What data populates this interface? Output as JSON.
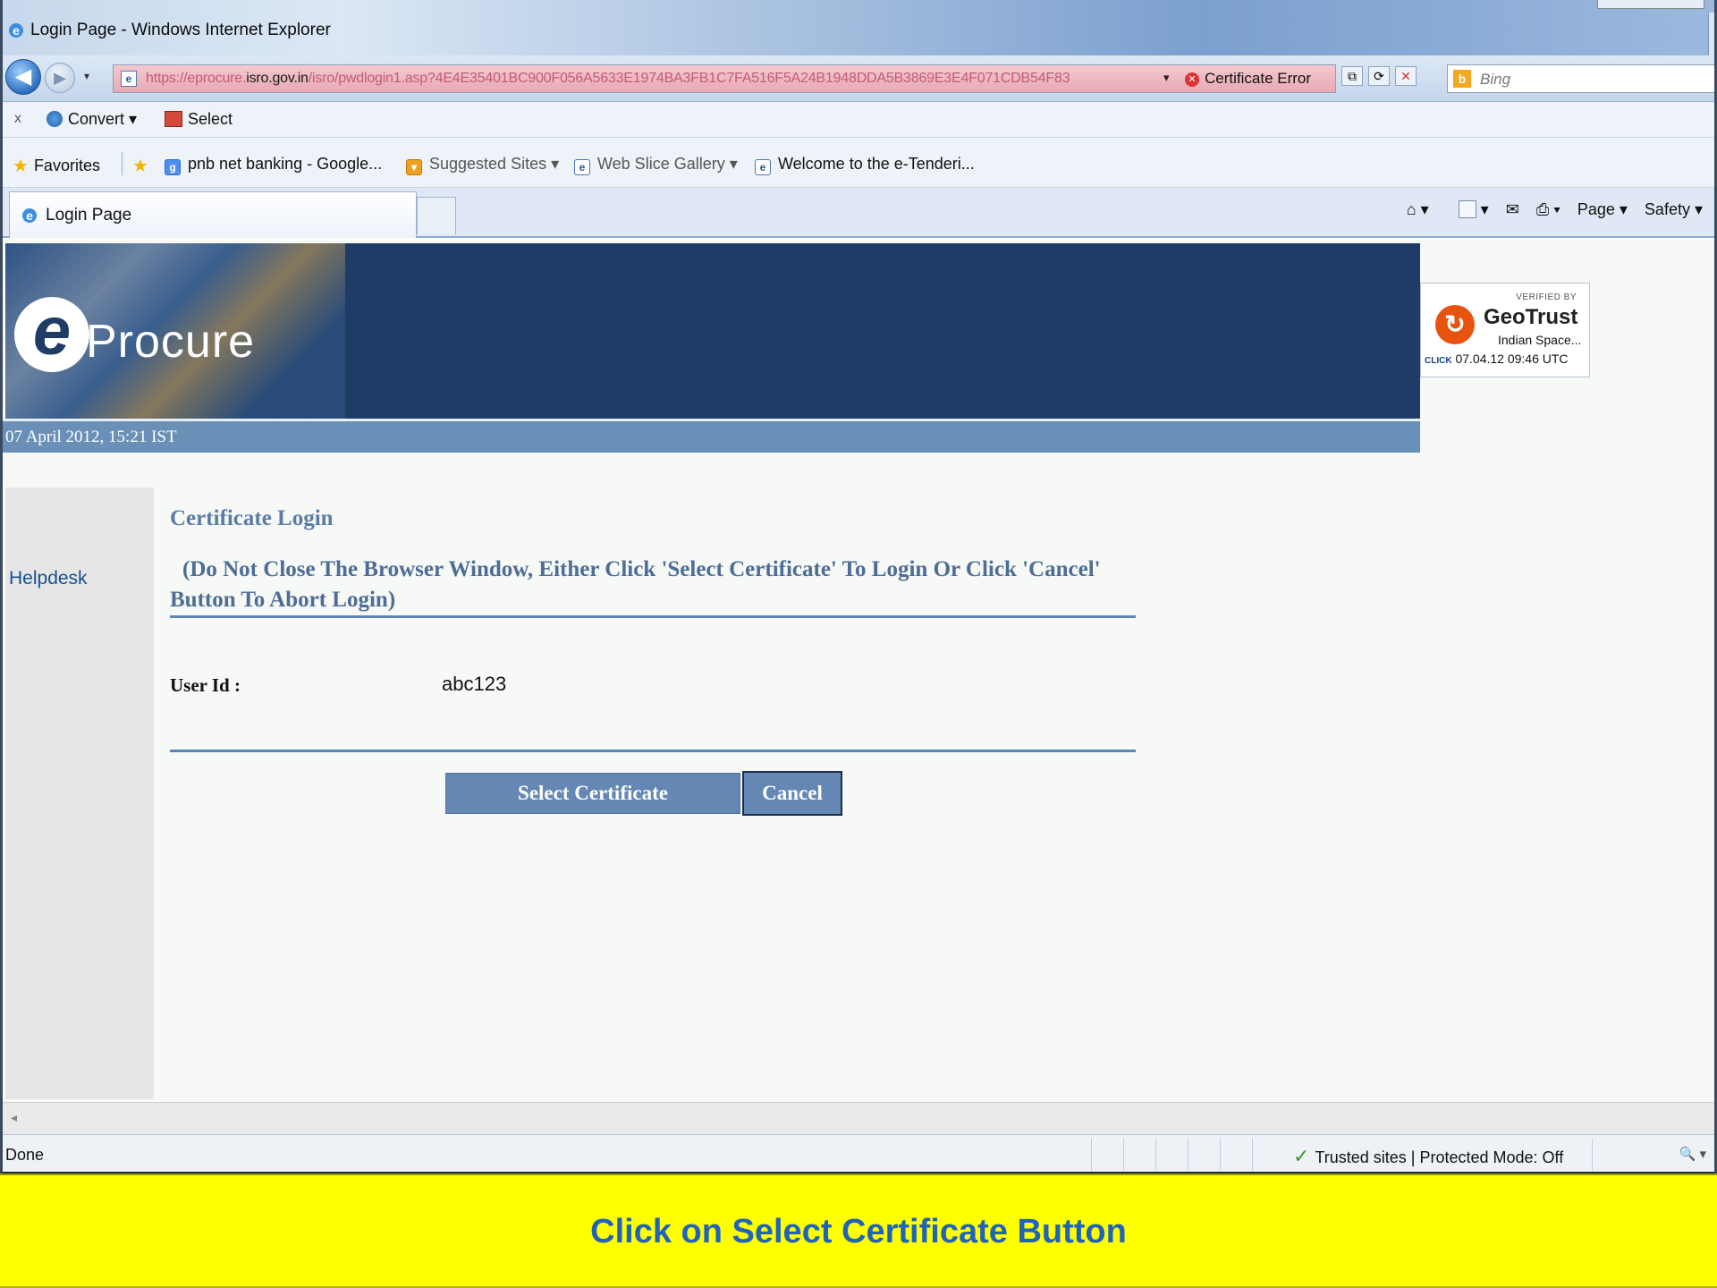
{
  "window": {
    "title": "Login Page - Windows Internet Explorer"
  },
  "address_bar": {
    "url_prefix": "https://eprocure.",
    "url_domain": "isro.gov.in",
    "url_path": "/isro/pwdlogin1.asp?4E4E35401BC900F056A5633E1974BA3FB1C7FA516F5A24B1948DDA5B3869E3E4F071CDB54F83",
    "certificate_error": "Certificate Error",
    "search_placeholder": "Bing"
  },
  "command_bar": {
    "close_label": "x",
    "convert_label": "Convert",
    "select_label": "Select"
  },
  "favorites_bar": {
    "favorites_label": "Favorites",
    "items": [
      "pnb net banking - Google...",
      "Suggested Sites ▾",
      "Web Slice Gallery ▾",
      "Welcome to the e-Tenderi..."
    ]
  },
  "tabs": {
    "active_label": "Login Page"
  },
  "toolbar_right": {
    "page_label": "Page ▾",
    "safety_label": "Safety ▾"
  },
  "banner": {
    "logo_letter": "e",
    "logo_text": "Procure",
    "badge": {
      "verified": "VERIFIED BY",
      "brand": "GeoTrust",
      "org": "Indian Space...",
      "click": "CLICK",
      "timestamp": "07.04.12 09:46 UTC"
    }
  },
  "datebar": {
    "text": "07 April 2012,  15:21  IST"
  },
  "leftnav": {
    "helpdesk": "Helpdesk"
  },
  "login": {
    "heading": "Certificate Login",
    "notice": "(Do Not Close The Browser Window, Either Click 'Select Certificate' To Login Or Click 'Cancel' Button To Abort Login)",
    "user_label": "User Id :",
    "user_value": "abc123",
    "select_button": "Select Certificate",
    "cancel_button": "Cancel"
  },
  "statusbar": {
    "status": "Done",
    "zone": "Trusted sites | Protected Mode: Off",
    "zoom_icon": "🔍 ▾"
  },
  "caption": {
    "text": "Click on Select Certificate Button"
  },
  "colors": {
    "banner": "#1f3c67",
    "datebar": "#6a90b8",
    "button": "#6488b3",
    "caption_bg": "#ffff00",
    "caption_text": "#1f64b9"
  }
}
